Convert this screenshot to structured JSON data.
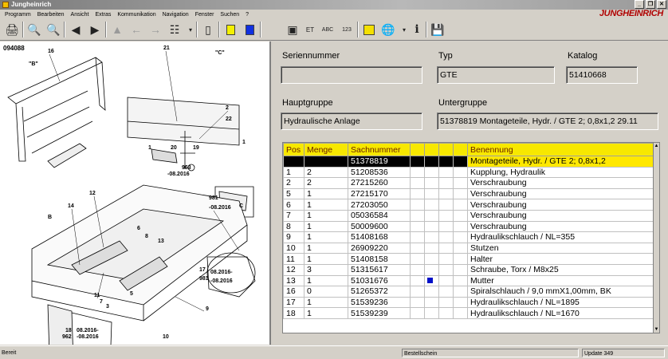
{
  "window": {
    "title": "Jungheinrich",
    "brand": "JUNGHEINRICH"
  },
  "menu": [
    "Programm",
    "Bearbeiten",
    "Ansicht",
    "Extras",
    "Kommunikation",
    "Navigation",
    "Fenster",
    "Suchen",
    "?"
  ],
  "toolbar": {
    "btn_et": "ET",
    "btn_abc": "ABC",
    "btn_123": "123"
  },
  "drawing": {
    "id": "094088",
    "callouts": [
      "16",
      "\"B\"",
      "21",
      "\"C\"",
      "2",
      "22",
      "1",
      "20",
      "19",
      "1",
      "963",
      "-08.2016",
      "981",
      "-08.2016",
      "C",
      "12",
      "14",
      "B",
      "6",
      "8",
      "13",
      "5",
      "17",
      "981",
      "08.2016-",
      "-08.2016",
      "11",
      "7",
      "3",
      "9",
      "18",
      "962",
      "08.2016-",
      "-08.2016",
      "10"
    ]
  },
  "fields": {
    "seriennummer_label": "Seriennummer",
    "seriennummer_value": "",
    "typ_label": "Typ",
    "typ_value": "GTE",
    "katalog_label": "Katalog",
    "katalog_value": "51410668",
    "hauptgruppe_label": "Hauptgruppe",
    "hauptgruppe_value": "Hydraulische Anlage",
    "untergruppe_label": "Untergruppe",
    "untergruppe_value": "51378819  Montageteile, Hydr. / GTE 2; 0,8x1,2 29.11"
  },
  "table": {
    "headers": [
      "Pos",
      "Menge",
      "Sachnummer",
      "",
      "",
      "",
      "",
      "Benennung"
    ],
    "rows": [
      {
        "pos": "",
        "menge": "",
        "sach": "51378819",
        "mark": false,
        "name": "Montageteile, Hydr. / GTE 2; 0,8x1,2"
      },
      {
        "pos": "1",
        "menge": "2",
        "sach": "51208536",
        "mark": false,
        "name": "Kupplung, Hydraulik"
      },
      {
        "pos": "2",
        "menge": "2",
        "sach": "27215260",
        "mark": false,
        "name": "Verschraubung"
      },
      {
        "pos": "5",
        "menge": "1",
        "sach": "27215170",
        "mark": false,
        "name": "Verschraubung"
      },
      {
        "pos": "6",
        "menge": "1",
        "sach": "27203050",
        "mark": false,
        "name": "Verschraubung"
      },
      {
        "pos": "7",
        "menge": "1",
        "sach": "05036584",
        "mark": false,
        "name": "Verschraubung"
      },
      {
        "pos": "8",
        "menge": "1",
        "sach": "50009600",
        "mark": false,
        "name": "Verschraubung"
      },
      {
        "pos": "9",
        "menge": "1",
        "sach": "51408168",
        "mark": false,
        "name": "Hydraulikschlauch / NL=355"
      },
      {
        "pos": "10",
        "menge": "1",
        "sach": "26909220",
        "mark": false,
        "name": "Stutzen"
      },
      {
        "pos": "11",
        "menge": "1",
        "sach": "51408158",
        "mark": false,
        "name": "Halter"
      },
      {
        "pos": "12",
        "menge": "3",
        "sach": "51315617",
        "mark": false,
        "name": "Schraube, Torx / M8x25"
      },
      {
        "pos": "13",
        "menge": "1",
        "sach": "51031676",
        "mark": true,
        "name": "Mutter"
      },
      {
        "pos": "16",
        "menge": "0",
        "sach": "51265372",
        "mark": false,
        "name": "Spiralschlauch / 9,0 mmX1,00mm,  BK"
      },
      {
        "pos": "17",
        "menge": "1",
        "sach": "51539236",
        "mark": false,
        "name": "Hydraulikschlauch / NL=1895"
      },
      {
        "pos": "18",
        "menge": "1",
        "sach": "51539239",
        "mark": false,
        "name": "Hydraulikschlauch / NL=1670"
      }
    ]
  },
  "status": {
    "left": "Bereit",
    "middle": "Bestellschein",
    "right": "Update 349"
  },
  "colors": {
    "header_bg": "#f7e800",
    "selection_bg": "#000000",
    "marker": "#0010c8"
  }
}
